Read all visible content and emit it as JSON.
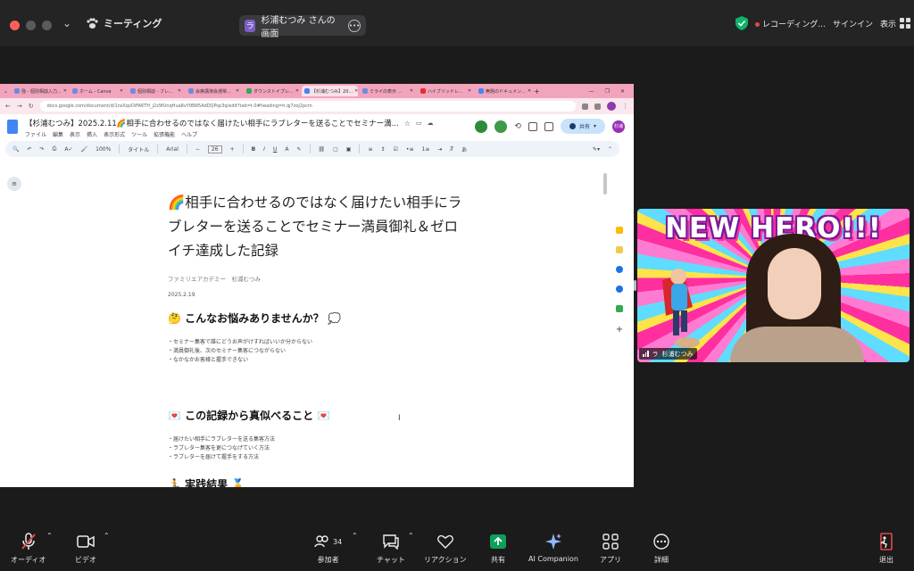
{
  "topbar": {
    "meeting_label": "ミーティング",
    "share_badge": "ラ",
    "share_label": "杉浦むつみ さんの画面",
    "recording_label": "レコーディング...",
    "signin_label": "サインイン",
    "view_label": "表示"
  },
  "browser": {
    "tabs": [
      {
        "label": "強 - 個別相談入力..."
      },
      {
        "label": "ホーム - Canva"
      },
      {
        "label": "個別相談 - ブレ..."
      },
      {
        "label": "会席講演会通常..."
      },
      {
        "label": "ダウンストイプレ..."
      },
      {
        "label": "【杉浦むつみ】20..."
      },
      {
        "label": "ミライの表示 ...",
        "extra": ""
      },
      {
        "label": "ハイブリッドレ..."
      },
      {
        "label": "無題のドキュメン..."
      }
    ],
    "address": "docs.google.com/document/d/1nsXqvDiFA6TH_j2z9fUnqHua8vYtBW5AdDQPsp3q/edit?tab=t.0#heading=h.qj7zoj2pcm",
    "doc_title": "【杉浦むつみ】2025.2.11🌈相手に合わせるのではなく届けたい相手にラブレターを送ることでセミナー満...",
    "menu": [
      "ファイル",
      "編集",
      "表示",
      "挿入",
      "表示形式",
      "ツール",
      "拡張機能",
      "ヘルプ"
    ],
    "share_button": "共有",
    "avatar_initials": "杉浦",
    "toolbar": {
      "zoom": "100%",
      "style": "タイトル",
      "font": "Arial",
      "font_size": "26"
    }
  },
  "document": {
    "title": "🌈相手に合わせるのではなく届けたい相手にラブレターを送ることでセミナー満員御礼＆ゼロイチ達成した記録",
    "meta": "ファミリエアカデミー　杉浦むつみ",
    "date": "2025.2.19",
    "section1": "🤔 こんなお悩みありませんか？ 💭",
    "bullets1": [
      "・セミナー集客で誰にどうお声がけすればいいか分からない",
      "・満員御礼後、次のセミナー集客につながらない",
      "・なかなかお客様と握手できない"
    ],
    "section2": "💌 この記録から真似べること 💌",
    "bullets2": [
      "・届けたい相手にラブレターを送る集客方法",
      "・ラブレター集客を更につなげていく方法",
      "・ラブレターを届けて握手をする方法"
    ],
    "section3": "🏃 実践結果 🏅"
  },
  "video": {
    "banner": "NEW HERO!!!",
    "name_badge": "ラ",
    "name": "杉浦むつみ"
  },
  "controls": {
    "audio": "オーディオ",
    "video": "ビデオ",
    "participants": "参加者",
    "participant_count": "34",
    "chat": "チャット",
    "reactions": "リアクション",
    "share": "共有",
    "ai_companion": "AI Companion",
    "apps": "アプリ",
    "details": "詳細",
    "leave": "退出"
  },
  "colors": {
    "share_green": "#0e9f5a",
    "leave_red": "#e5484d",
    "browser_tab_pink": "#f3a4bd"
  }
}
